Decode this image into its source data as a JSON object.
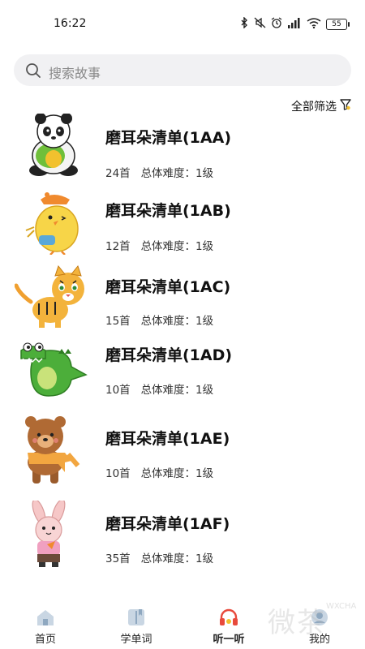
{
  "status": {
    "time": "16:22",
    "battery": "55"
  },
  "search": {
    "placeholder": "搜索故事"
  },
  "filter": {
    "label": "全部筛选"
  },
  "stories": [
    {
      "title": "磨耳朵清单(1AA)",
      "count": "24首",
      "difficulty": "总体难度：1级",
      "animal": "panda"
    },
    {
      "title": "磨耳朵清单(1AB)",
      "count": "12首",
      "difficulty": "总体难度：1级",
      "animal": "chick"
    },
    {
      "title": "磨耳朵清单(1AC)",
      "count": "15首",
      "difficulty": "总体难度：1级",
      "animal": "tiger"
    },
    {
      "title": "磨耳朵清单(1AD)",
      "count": "10首",
      "difficulty": "总体难度：1级",
      "animal": "crocodile"
    },
    {
      "title": "磨耳朵清单(1AE)",
      "count": "10首",
      "difficulty": "总体难度：1级",
      "animal": "bear"
    },
    {
      "title": "磨耳朵清单(1AF)",
      "count": "35首",
      "difficulty": "总体难度：1级",
      "animal": "rabbit"
    }
  ],
  "tabs": [
    {
      "label": "首页",
      "icon": "home-icon",
      "active": false
    },
    {
      "label": "学单词",
      "icon": "book-icon",
      "active": false
    },
    {
      "label": "听一听",
      "icon": "headphones-icon",
      "active": true
    },
    {
      "label": "我的",
      "icon": "profile-icon",
      "active": false
    }
  ],
  "watermark": {
    "text": "微茶",
    "small": "WXCHA"
  },
  "colors": {
    "active_tab": "#e84a3c",
    "filter_accent": "#f2c12e"
  }
}
